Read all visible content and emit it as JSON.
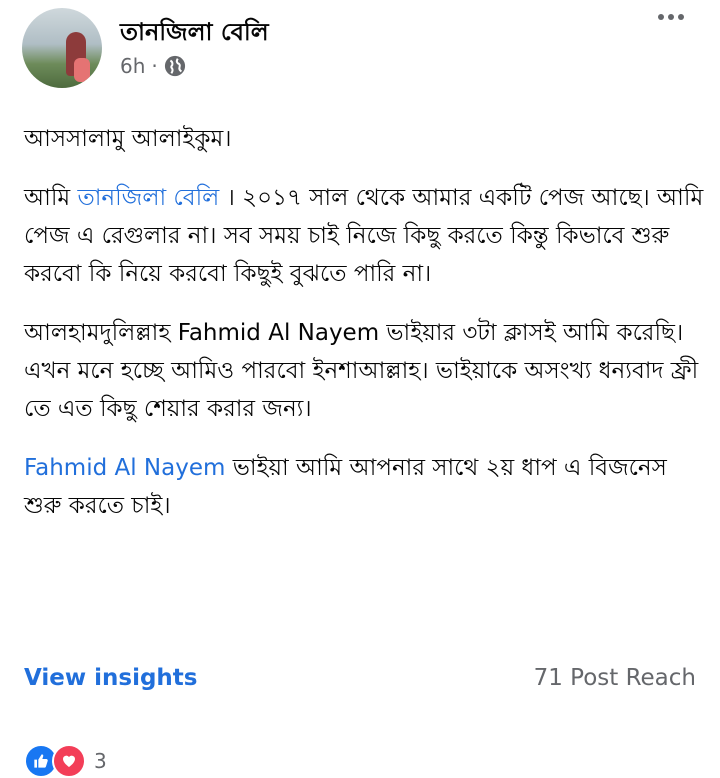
{
  "post": {
    "author": "তানজিলা বেলি",
    "time": "6h",
    "separator": "·",
    "privacy_icon": "globe-icon",
    "more_icon": "more-options-icon"
  },
  "content": {
    "p1": "আসসালামু আলাইকুম।",
    "p2_prefix": "আমি ",
    "p2_link": "তানজিলা বেলি",
    "p2_rest": " । ২০১৭ সাল থেকে আমার একটি পেজ আছে। আমি পেজ এ রেগুলার না। সব সময় চাই নিজে কিছু করতে কিন্তু কিভাবে শুরু করবো কি নিয়ে করবো কিছুই বুঝতে পারি না।",
    "p3": "আলহামদুলিল্লাহ Fahmid Al Nayem ভাইয়ার ৩টা ক্লাসই আমি করেছি। এখন মনে হচ্ছে আমিও পারবো ইনশাআল্লাহ। ভাইয়াকে অসংখ্য ধন্যবাদ ফ্রী তে এত কিছু শেয়ার করার জন্য।",
    "p4_link": "Fahmid Al Nayem",
    "p4_rest": " ভাইয়া আমি আপনার সাথে ২য় ধাপ এ বিজনেস শুরু করতে চাই।"
  },
  "footer": {
    "insights_label": "View insights",
    "reach_text": "71 Post Reach",
    "reaction_count": "3"
  },
  "colors": {
    "link": "#216fdb",
    "muted": "#65676b",
    "like": "#1877f2",
    "love": "#f33e58"
  }
}
